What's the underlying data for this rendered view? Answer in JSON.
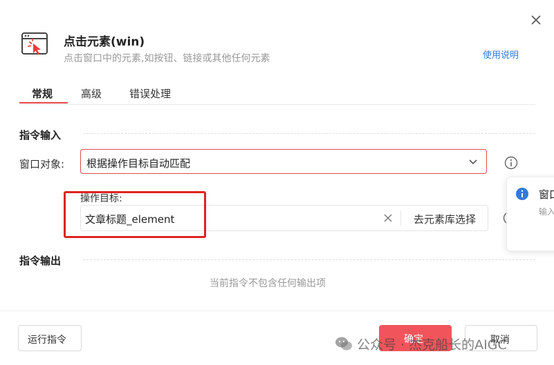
{
  "dialog": {
    "title": "点击元素(win)",
    "subtitle": "点击窗口中的元素,如按钮、链接或其他任何元素",
    "help_link": "使用说明",
    "close_icon": "close-icon",
    "app_icon": "click-window-icon"
  },
  "tabs": [
    {
      "label": "常规",
      "active": true
    },
    {
      "label": "高级",
      "active": false
    },
    {
      "label": "错误处理",
      "active": false
    }
  ],
  "input_section": {
    "title": "指令输入",
    "window_object": {
      "label": "窗口对象:",
      "value": "根据操作目标自动匹配"
    },
    "operation_target": {
      "label": "操作目标:",
      "value": "文章标题_element",
      "library_button": "去元素库选择"
    }
  },
  "popover": {
    "title": "窗口",
    "subtitle": "输入"
  },
  "output_section": {
    "title": "指令输出",
    "empty_text": "当前指令不包含任何输出项"
  },
  "footer": {
    "run_button": "运行指令",
    "ok_button": "确定",
    "cancel_button": "取消"
  },
  "watermark": {
    "text": "公众号 · 杰克船长的AIGC"
  },
  "colors": {
    "accent": "#e8474a",
    "primary_button": "#f2545b",
    "link": "#2f7bd9",
    "info": "#2f7bd9",
    "highlight_box": "#e02222"
  }
}
